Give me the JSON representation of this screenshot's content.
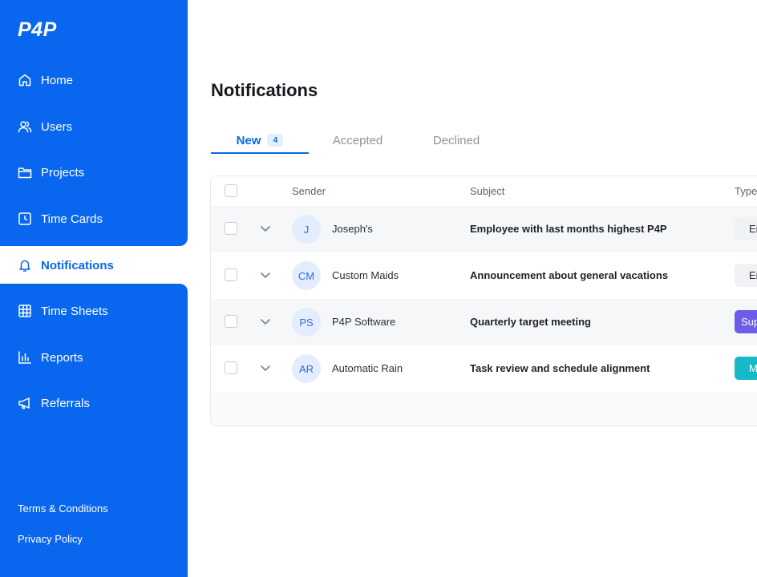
{
  "app": {
    "logo": "P4P"
  },
  "sidebar": {
    "items": [
      {
        "label": "Home",
        "icon": "home-icon"
      },
      {
        "label": "Users",
        "icon": "users-icon"
      },
      {
        "label": "Projects",
        "icon": "folder-icon"
      },
      {
        "label": "Time Cards",
        "icon": "clock-icon"
      },
      {
        "label": "Notifications",
        "icon": "bell-icon",
        "active": true
      },
      {
        "label": "Time Sheets",
        "icon": "grid-icon"
      },
      {
        "label": "Reports",
        "icon": "bar-chart-icon"
      },
      {
        "label": "Referrals",
        "icon": "megaphone-icon"
      }
    ],
    "footer": {
      "terms": "Terms & Conditions",
      "privacy": "Privacy Policy"
    }
  },
  "main": {
    "title": "Notifications",
    "tabs": [
      {
        "label": "New",
        "badge": "4",
        "active": true
      },
      {
        "label": "Accepted"
      },
      {
        "label": "Declined"
      }
    ],
    "table": {
      "columns": {
        "sender": "Sender",
        "subject": "Subject",
        "type": "Type"
      },
      "rows": [
        {
          "initials": "J",
          "sender": "Joseph's",
          "subject": "Employee with last months highest P4P",
          "type": "Er"
        },
        {
          "initials": "CM",
          "sender": "Custom Maids",
          "subject": "Announcement about general vacations",
          "type": "Er"
        },
        {
          "initials": "PS",
          "sender": "P4P Software",
          "subject": "Quarterly target meeting",
          "type": "Sup"
        },
        {
          "initials": "AR",
          "sender": "Automatic Rain",
          "subject": "Task review and schedule alignment",
          "type": "M"
        }
      ]
    }
  },
  "colors": {
    "brand": "#0867ee",
    "badge_gray": "#f1f2f4",
    "badge_purple": "#6c5ce7",
    "badge_teal": "#16b9c8"
  }
}
